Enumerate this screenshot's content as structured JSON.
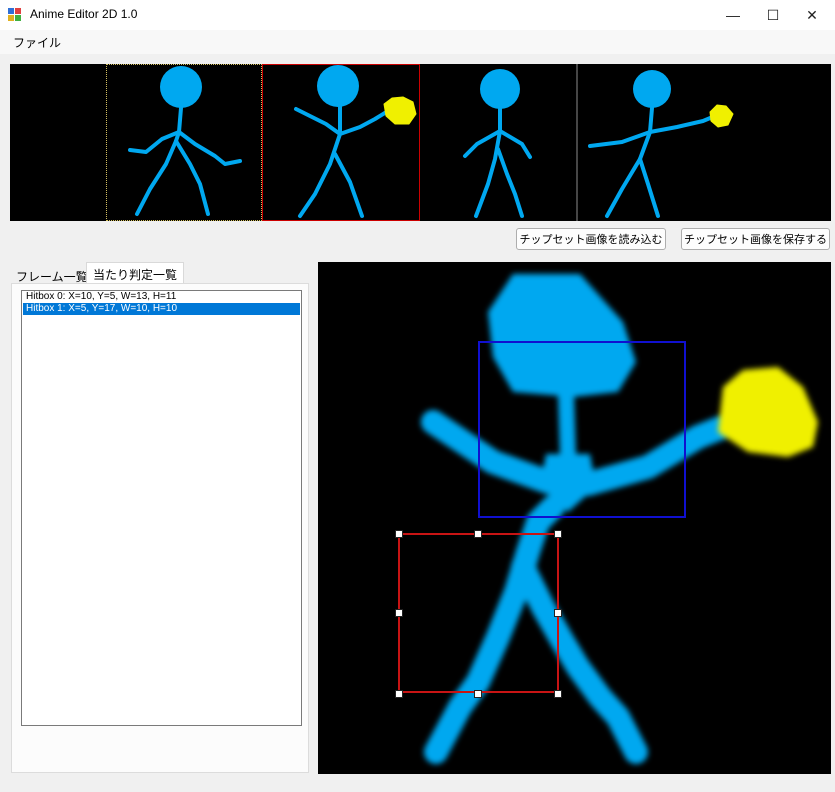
{
  "window": {
    "title": "Anime Editor 2D 1.0",
    "minimize_glyph": "—",
    "maximize_glyph": "☐",
    "close_glyph": "✕"
  },
  "menu": {
    "file_label": "ファイル"
  },
  "toolbar": {
    "load_button_label": "チップセット画像を読み込む",
    "save_button_label": "チップセット画像を保存する"
  },
  "tabs": [
    {
      "label": "フレーム一覧",
      "active": false
    },
    {
      "label": "当たり判定一覧",
      "active": true
    }
  ],
  "hitboxes": [
    {
      "label": "Hitbox 0: X=10, Y=5, W=13, H=11",
      "selected": false
    },
    {
      "label": "Hitbox 1: X=5, Y=17, W=10, H=10",
      "selected": true
    }
  ],
  "chipset": {
    "frame_count": 5,
    "selected_frame_index": 1
  },
  "colors": {
    "figure": "#00a8f0",
    "fist": "#f0f000",
    "selected_hitbox": "#c81414",
    "other_hitbox": "#1010d0",
    "selection": "#0078d7"
  },
  "icons": {
    "app": "app-icon",
    "minimize": "minimize-icon",
    "maximize": "maximize-icon",
    "close": "close-icon"
  }
}
